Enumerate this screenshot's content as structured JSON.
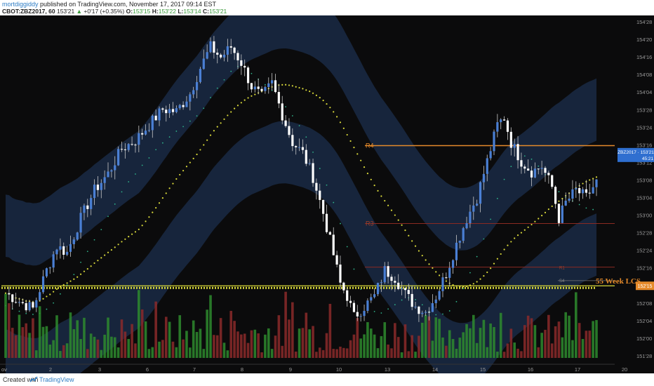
{
  "header": {
    "author": "mortdiggiddy",
    "published": "published on TradingView.com, November 17, 2017 09:14 EST",
    "symbol": "CBOT:ZBZ2017, 60",
    "last": "153'21",
    "change": "+0'17 (+0.35%)",
    "o_label": "O:",
    "o_value": "153'15",
    "h_label": "H:",
    "h_value": "153'22",
    "l_label": "L:",
    "l_value": "153'14",
    "c_label": "C:",
    "c_value": "153'21"
  },
  "footer": {
    "created_with": "Created with",
    "brand": "TradingView",
    "logo_icon": "tradingview-logo-icon"
  },
  "colors": {
    "background": "#0b0b0c",
    "band": "#1a2a45",
    "candle_up": "#4a7fd4",
    "candle_down": "#ffffff",
    "wick": "#c8c8c8",
    "volume_up": "#2e8b2e",
    "volume_down": "#8b2a2a",
    "yellow_dots": "#d8d83a",
    "green_dots": "#2fb28a",
    "level_orange": "#e58a2a",
    "level_red": "#8a2a22",
    "lcs_line": "#d8d83a",
    "axis_text": "#9a9a9a",
    "price_tag": "#2f6fd0",
    "lcs_tag": "#e58a2a"
  },
  "chart_data": {
    "type": "candlestick",
    "symbol": "CBOT:ZBZ2017",
    "interval": "60",
    "y_axis": {
      "ticks": [
        "154'28",
        "154'20",
        "154'16",
        "154'08",
        "154'04",
        "153'28",
        "153'24",
        "153'16",
        "153'12",
        "153'08",
        "153'04",
        "153'00",
        "152'28",
        "152'24",
        "152'16",
        "152'12",
        "152'08",
        "152'04",
        "152'00",
        "151'28"
      ],
      "ylim": [
        151.8,
        154.95
      ]
    },
    "x_axis": {
      "ticks": [
        "ov",
        "2",
        "3",
        "6",
        "7",
        "8",
        "9",
        "10",
        "13",
        "14",
        "15",
        "16",
        "17",
        "20"
      ]
    },
    "close_path": [
      [
        0,
        152.33
      ],
      [
        4,
        152.25
      ],
      [
        8,
        152.18
      ],
      [
        12,
        152.55
      ],
      [
        15,
        152.78
      ],
      [
        18,
        152.72
      ],
      [
        22,
        153.05
      ],
      [
        26,
        153.32
      ],
      [
        30,
        153.48
      ],
      [
        34,
        153.72
      ],
      [
        38,
        153.8
      ],
      [
        42,
        153.95
      ],
      [
        46,
        154.1
      ],
      [
        50,
        154.08
      ],
      [
        54,
        154.25
      ],
      [
        57,
        154.5
      ],
      [
        60,
        154.7
      ],
      [
        63,
        154.6
      ],
      [
        66,
        154.7
      ],
      [
        69,
        154.55
      ],
      [
        72,
        154.32
      ],
      [
        75,
        154.22
      ],
      [
        78,
        154.35
      ],
      [
        81,
        154.05
      ],
      [
        84,
        153.78
      ],
      [
        87,
        153.68
      ],
      [
        90,
        153.45
      ],
      [
        93,
        153.1
      ],
      [
        96,
        152.7
      ],
      [
        98,
        152.42
      ],
      [
        100,
        152.3
      ],
      [
        102,
        152.1
      ],
      [
        105,
        152.2
      ],
      [
        108,
        152.3
      ],
      [
        111,
        152.55
      ],
      [
        114,
        152.48
      ],
      [
        117,
        152.32
      ],
      [
        120,
        152.2
      ],
      [
        123,
        152.15
      ],
      [
        126,
        152.3
      ],
      [
        129,
        152.52
      ],
      [
        132,
        152.8
      ],
      [
        135,
        153.05
      ],
      [
        138,
        153.25
      ],
      [
        141,
        153.6
      ],
      [
        144,
        153.95
      ],
      [
        146,
        154.02
      ],
      [
        148,
        153.78
      ],
      [
        151,
        153.6
      ],
      [
        154,
        153.5
      ],
      [
        157,
        153.55
      ],
      [
        160,
        153.35
      ],
      [
        162,
        153.05
      ],
      [
        164,
        153.2
      ],
      [
        167,
        153.32
      ],
      [
        170,
        153.25
      ],
      [
        173,
        153.4
      ]
    ],
    "bars": 174,
    "series": [
      {
        "name": "R4",
        "values": [
          153.75
        ]
      },
      {
        "name": "R3",
        "values": [
          153.0
        ]
      },
      {
        "name": "55 Week LCS",
        "values": [
          152.4
        ]
      }
    ],
    "levels": [
      {
        "label": "R4",
        "value": 153.75,
        "style": "orange"
      },
      {
        "label": "R3",
        "value": 153.0,
        "style": "red"
      },
      {
        "label": "R1",
        "value": 152.58,
        "style": "red"
      },
      {
        "label": "S4",
        "value": 152.45,
        "style": "faint"
      },
      {
        "label": "55 Week LCS",
        "value": 152.4,
        "style": "lcs"
      }
    ],
    "price_tags": [
      {
        "text": "ZBZ2017 · 153'21",
        "sub": "45:21",
        "value": 153.66
      },
      {
        "text": "152'15",
        "value": 152.4
      }
    ]
  }
}
